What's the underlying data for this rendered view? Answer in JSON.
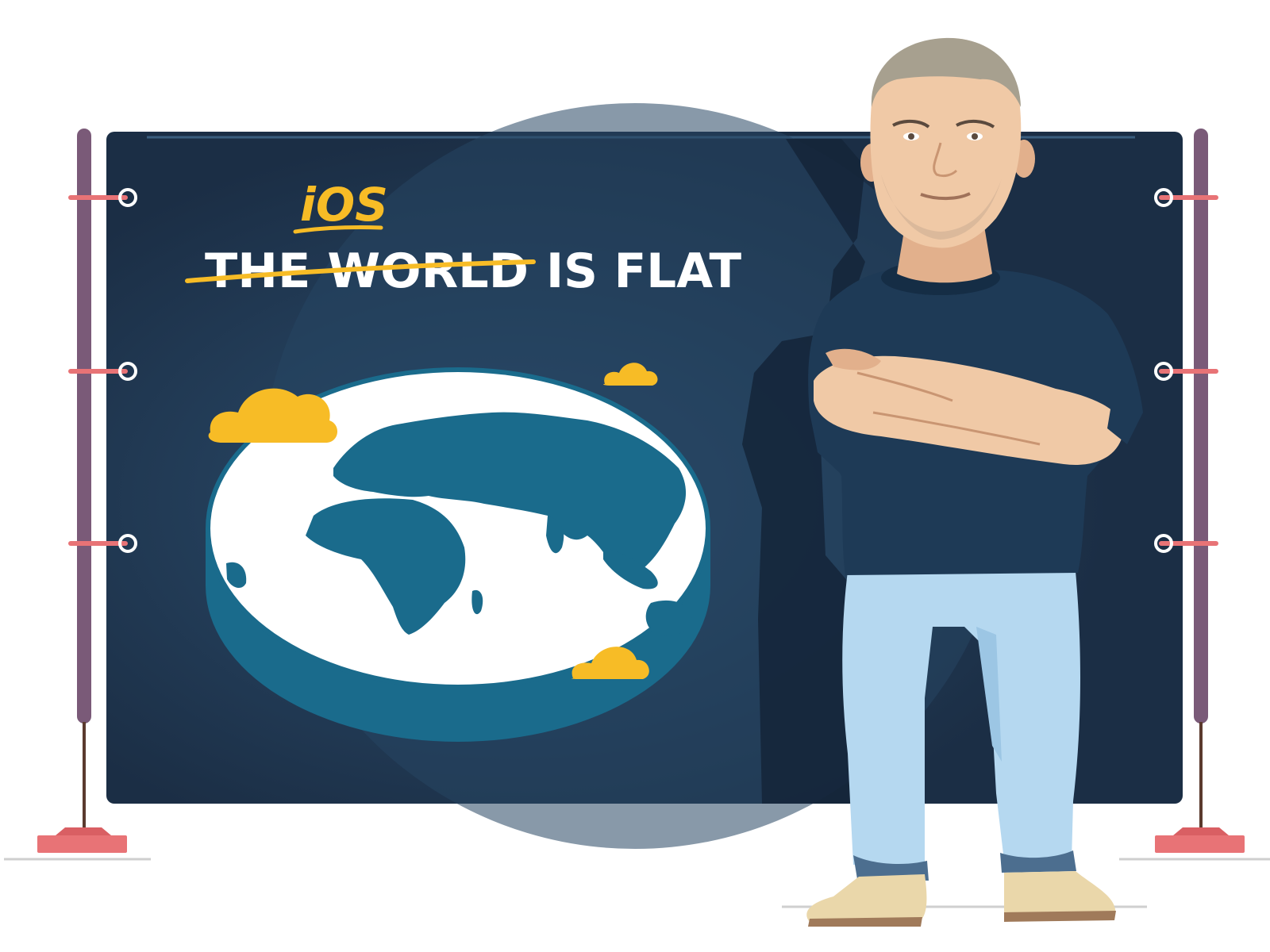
{
  "banner": {
    "handwritten_word": "iOS",
    "headline_struck": "THE WORLD",
    "headline_rest": "IS FLAT"
  },
  "colors": {
    "banner_bg": "#1b2e45",
    "banner_glow": "#2a4a68",
    "pole": "#7a5a78",
    "pole_base": "#e87376",
    "strap": "#e87376",
    "globe_land": "#1a6b8c",
    "globe_rim": "#1a6b8c",
    "globe_face": "#ffffff",
    "cloud": "#f7bc26",
    "accent_yellow": "#f7bc26",
    "headline_white": "#ffffff",
    "shirt": "#1e3a56",
    "jeans": "#b5d8f0",
    "skin": "#f0c9a6",
    "shoes": "#ead7aa",
    "hair": "#a7a08f"
  }
}
